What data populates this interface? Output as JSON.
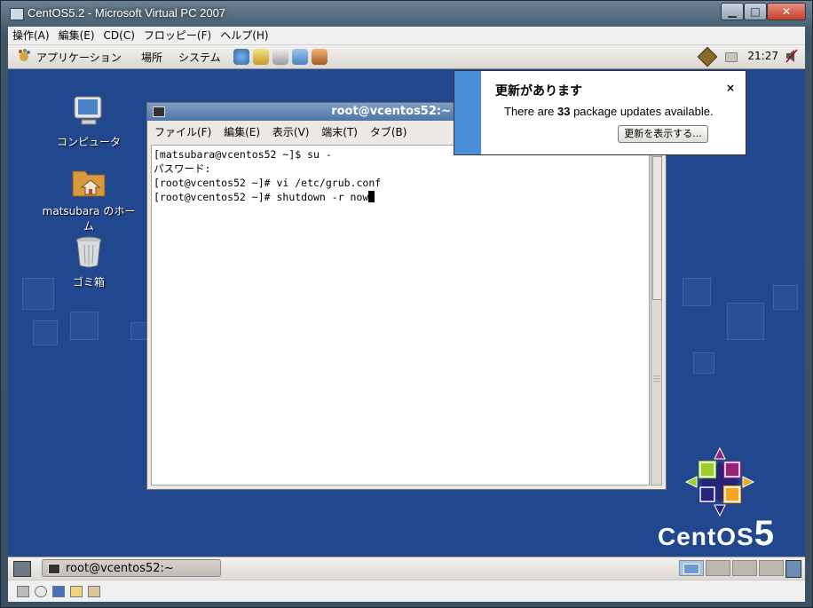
{
  "vpc": {
    "title": "CentOS5.2 - Microsoft Virtual PC 2007",
    "menus": [
      "操作(A)",
      "編集(E)",
      "CD(C)",
      "フロッピー(F)",
      "ヘルプ(H)"
    ]
  },
  "top_panel": {
    "menus": [
      "アプリケーション",
      "場所",
      "システム"
    ],
    "clock": "21:27"
  },
  "desktop_icons": [
    {
      "label": "コンピュータ",
      "icon": "computer-icon"
    },
    {
      "label": "matsubara のホーム",
      "icon": "home-folder-icon"
    },
    {
      "label": "ゴミ箱",
      "icon": "trash-icon"
    }
  ],
  "terminal": {
    "title": "root@vcentos52:~",
    "menus": [
      "ファイル(F)",
      "編集(E)",
      "表示(V)",
      "端末(T)",
      "タブ(B)"
    ],
    "lines": [
      "[matsubara@vcentos52 ~]$ su -",
      "パスワード:",
      "[root@vcentos52 ~]# vi /etc/grub.conf",
      "[root@vcentos52 ~]# shutdown -r now"
    ]
  },
  "notification": {
    "title": "更新があります",
    "close": "×",
    "body_prefix": "There are ",
    "count": "33",
    "body_suffix": " package updates available.",
    "button": "更新を表示する..."
  },
  "logo": {
    "text": "CentOS",
    "version": "5"
  },
  "bottom_panel": {
    "task": "root@vcentos52:~"
  },
  "colors": {
    "desktop": "#21478f",
    "notify_strip": "#4a8fd8",
    "terminal_title": "#4f74a7"
  }
}
